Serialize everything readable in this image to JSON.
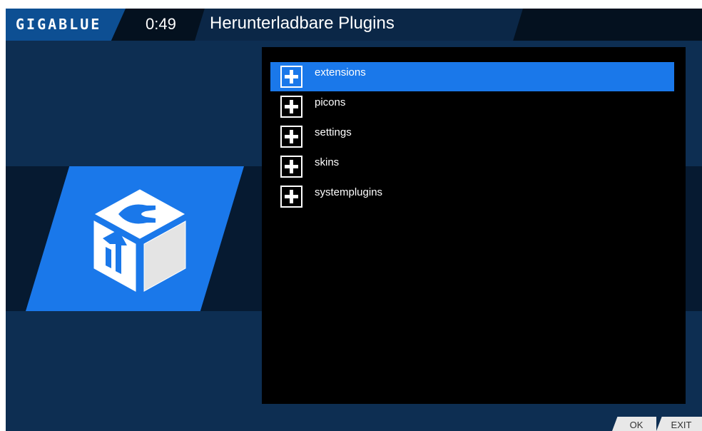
{
  "header": {
    "logo_text": "GIGABLUE",
    "clock": "0:49",
    "title": "Herunterladbare Plugins"
  },
  "list": {
    "items": [
      {
        "label": "extensions",
        "icon": "plus-icon",
        "selected": true
      },
      {
        "label": "picons",
        "icon": "plus-icon",
        "selected": false
      },
      {
        "label": "settings",
        "icon": "plus-icon",
        "selected": false
      },
      {
        "label": "skins",
        "icon": "plus-icon",
        "selected": false
      },
      {
        "label": "systemplugins",
        "icon": "plus-icon",
        "selected": false
      }
    ]
  },
  "footer": {
    "ok_label": "OK",
    "exit_label": "EXIT"
  },
  "colors": {
    "background": "#0d2e52",
    "accent": "#1a78ea",
    "panel": "#000000"
  },
  "icons": {
    "plugin_icon": "plugin-cube-icon"
  }
}
